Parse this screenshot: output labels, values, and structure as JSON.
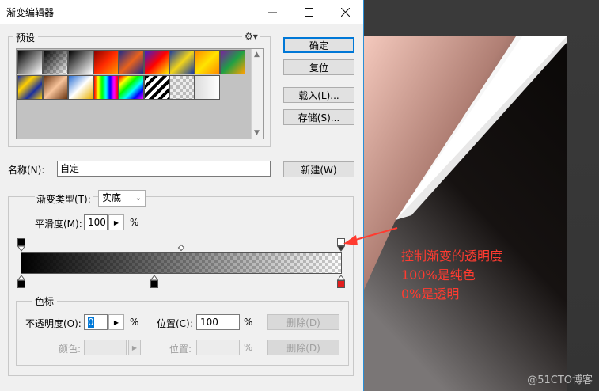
{
  "window": {
    "title": "渐变编辑器"
  },
  "presets": {
    "label": "预设"
  },
  "buttons": {
    "ok": "确定",
    "reset": "复位",
    "load": "载入(L)...",
    "save": "存储(S)...",
    "new": "新建(W)"
  },
  "name": {
    "label": "名称(N):",
    "value": "自定"
  },
  "gradient": {
    "type_label": "渐变类型(T):",
    "type_value": "实底",
    "smoothness_label": "平滑度(M):",
    "smoothness_value": "100",
    "percent": "%"
  },
  "color_stops": {
    "label": "色标",
    "opacity_label": "不透明度(O):",
    "opacity_value": "0",
    "location_label": "位置(C):",
    "location_value": "100",
    "delete_label": "删除(D)",
    "color_label": "颜色:",
    "location2_label": "位置:",
    "percent": "%"
  },
  "annotation": {
    "line1": "控制渐变的透明度",
    "line2": "100%是纯色",
    "line3": "0%是透明",
    "color": "#ff3b30"
  },
  "watermark": "@51CTO博客",
  "accent": "#0078d7"
}
